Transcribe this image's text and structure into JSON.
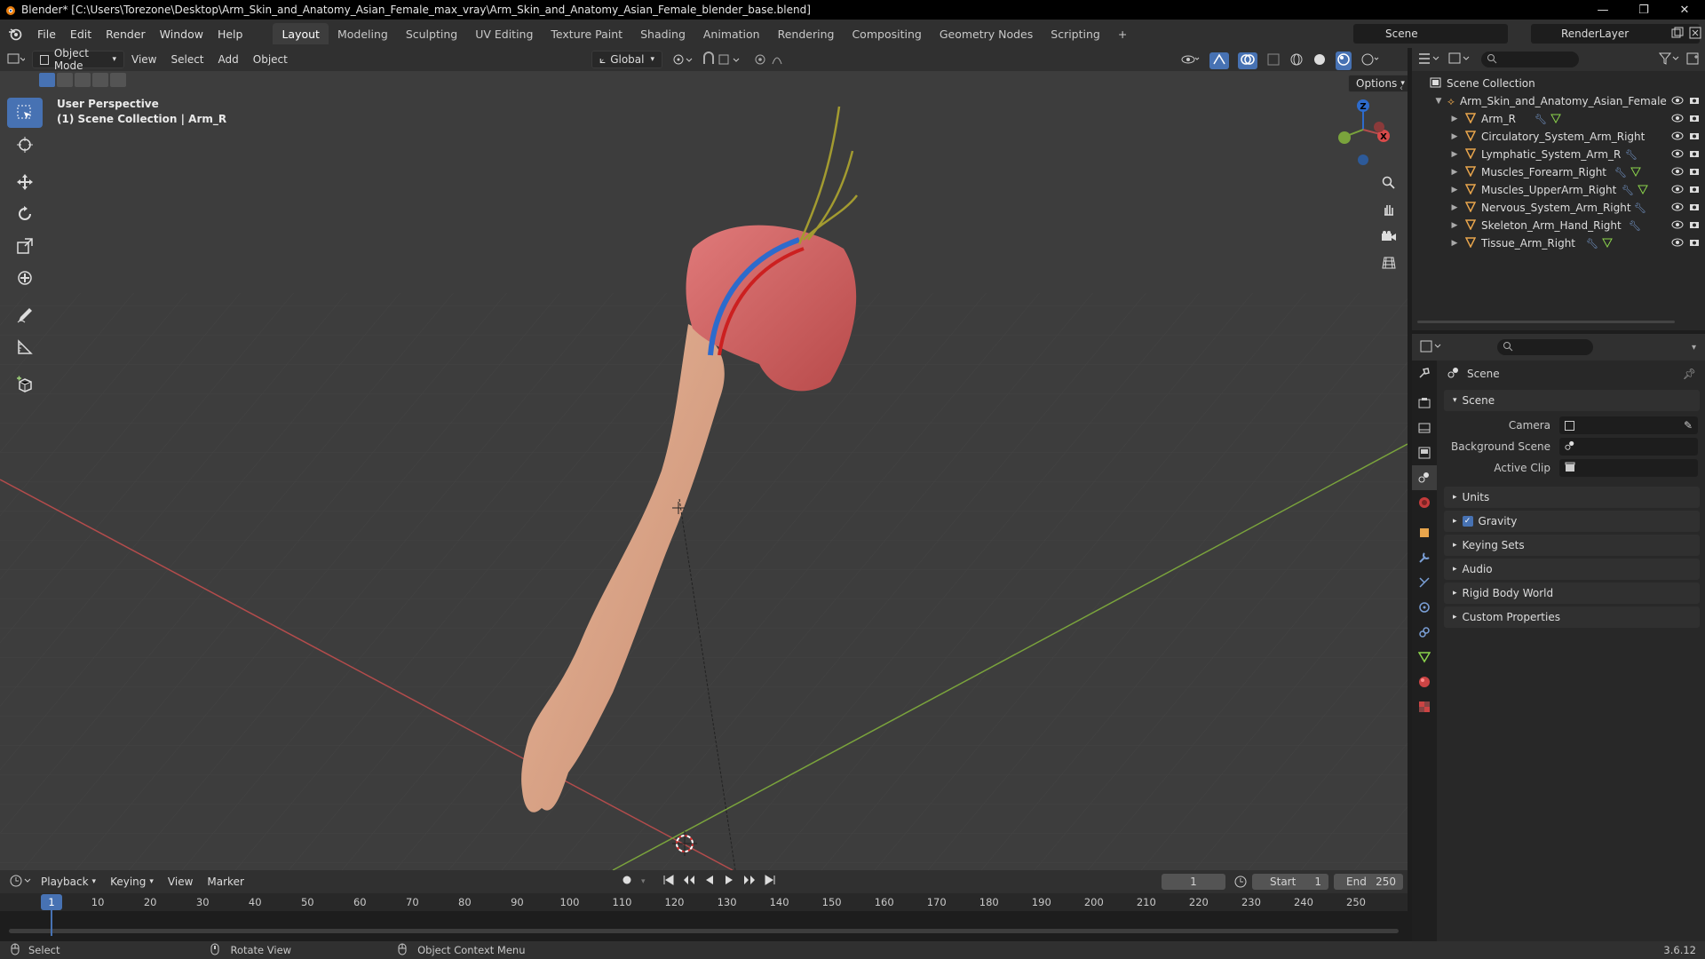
{
  "window": {
    "title": "Blender* [C:\\Users\\Torezone\\Desktop\\Arm_Skin_and_Anatomy_Asian_Female_max_vray\\Arm_Skin_and_Anatomy_Asian_Female_blender_base.blend]",
    "controls": [
      "—",
      "❐",
      "✕"
    ]
  },
  "menu": [
    "File",
    "Edit",
    "Render",
    "Window",
    "Help"
  ],
  "workspaces": [
    "Layout",
    "Modeling",
    "Sculpting",
    "UV Editing",
    "Texture Paint",
    "Shading",
    "Animation",
    "Rendering",
    "Compositing",
    "Geometry Nodes",
    "Scripting",
    "+"
  ],
  "active_workspace": "Layout",
  "scene_selector": "Scene",
  "renderlayer_selector": "RenderLayer",
  "viewport_header": {
    "mode": "Object Mode",
    "menus": [
      "View",
      "Select",
      "Add",
      "Object"
    ],
    "transform_orientation": "Global",
    "options_label": "Options"
  },
  "viewport": {
    "perspective_label": "User Perspective",
    "collection_label": "(1) Scene Collection | Arm_R"
  },
  "outliner": {
    "root": "Scene Collection",
    "collection": "Arm_Skin_and_Anatomy_Asian_Female",
    "objects": [
      "Arm_R",
      "Circulatory_System_Arm_Right",
      "Lymphatic_System_Arm_R",
      "Muscles_Forearm_Right",
      "Muscles_UpperArm_Right",
      "Nervous_System_Arm_Right",
      "Skeleton_Arm_Hand_Right",
      "Tissue_Arm_Right"
    ]
  },
  "properties": {
    "context_title": "Scene",
    "panel_scene": "Scene",
    "fields": [
      {
        "label": "Camera",
        "value": ""
      },
      {
        "label": "Background Scene",
        "value": ""
      },
      {
        "label": "Active Clip",
        "value": ""
      }
    ],
    "panels": [
      "Units",
      "Gravity",
      "Keying Sets",
      "Audio",
      "Rigid Body World",
      "Custom Properties"
    ],
    "gravity_checked": true
  },
  "timeline": {
    "menus": [
      "Playback",
      "Keying",
      "View",
      "Marker"
    ],
    "current_frame": "1",
    "start_label": "Start",
    "start": "1",
    "end_label": "End",
    "end": "250",
    "ticks": [
      "1",
      "10",
      "20",
      "30",
      "40",
      "50",
      "60",
      "70",
      "80",
      "90",
      "100",
      "110",
      "120",
      "130",
      "140",
      "150",
      "160",
      "170",
      "180",
      "190",
      "200",
      "210",
      "220",
      "230",
      "240",
      "250"
    ]
  },
  "statusbar": {
    "select": "Select",
    "rotate": "Rotate View",
    "context": "Object Context Menu",
    "version": "3.6.12"
  },
  "colors": {
    "accent": "#4772b3",
    "x_axis": "#b34c4c",
    "y_axis": "#7aa33c",
    "z_axis": "#2d6bcc"
  }
}
